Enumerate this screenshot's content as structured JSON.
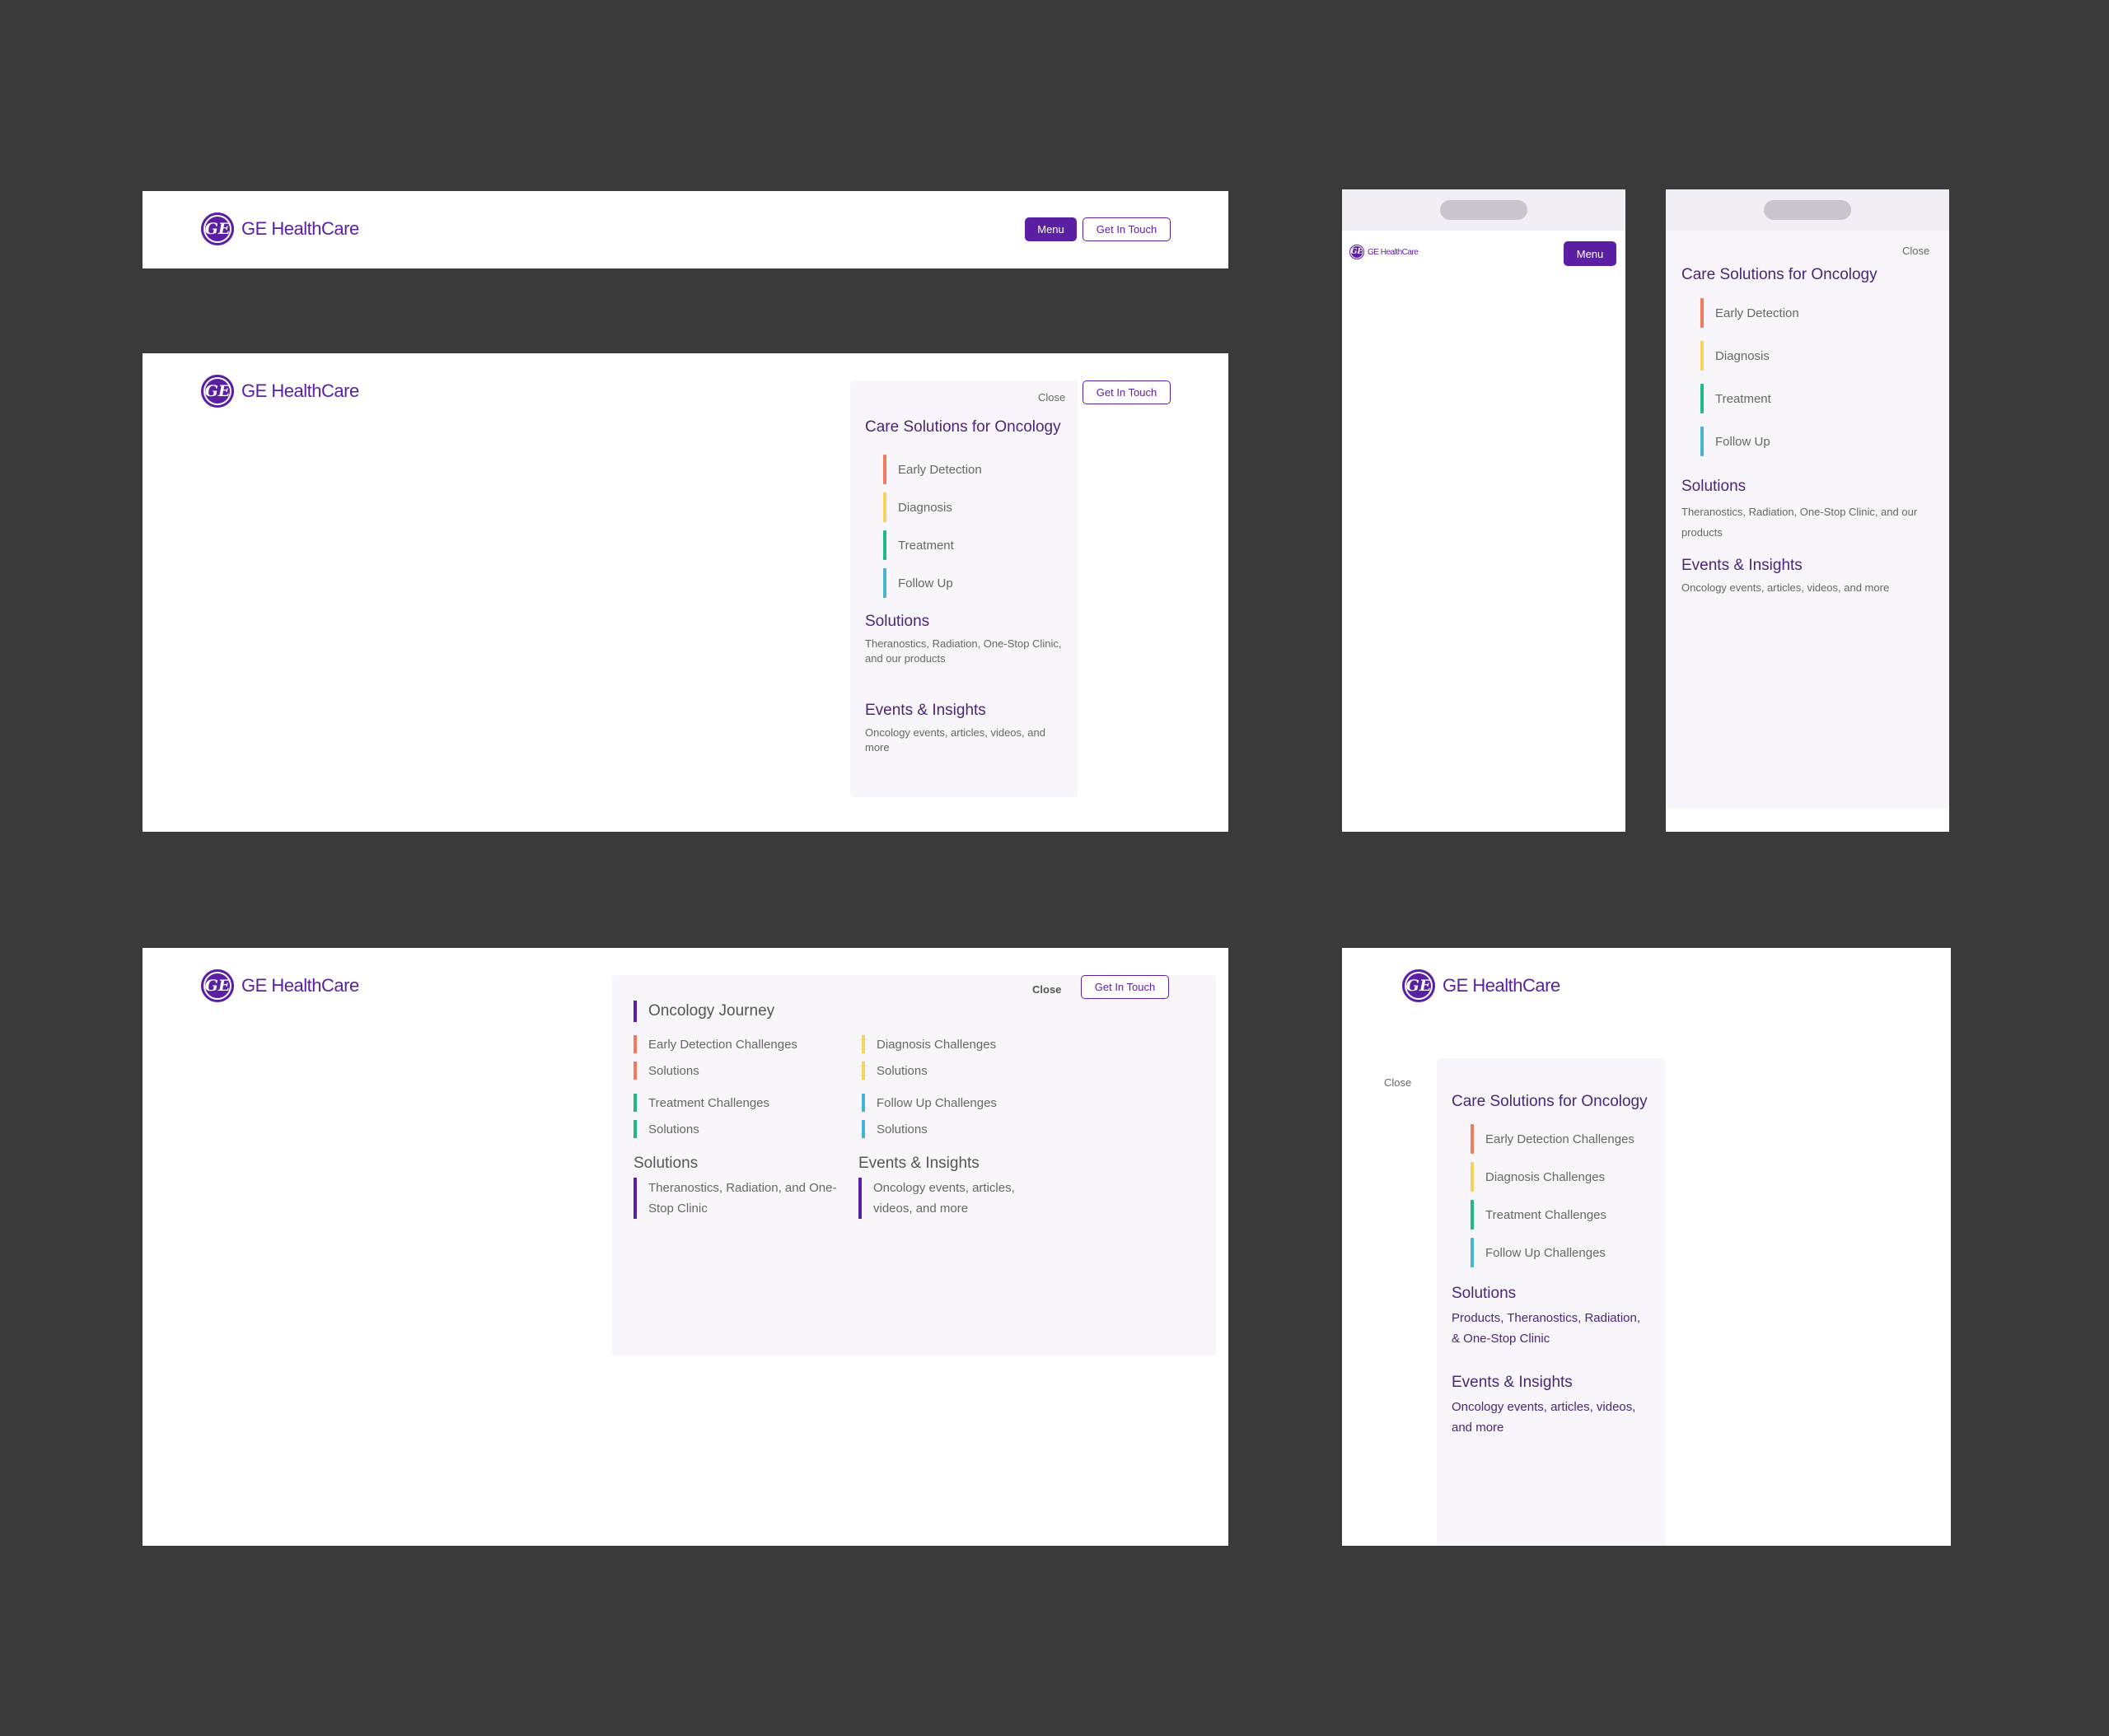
{
  "brand": {
    "name": "GE HealthCare",
    "monogram": "GE",
    "logo_icon": "ge-monogram-icon",
    "primary_color": "#5a1fa3"
  },
  "header": {
    "menu_label": "Menu",
    "cta_label": "Get In Touch",
    "close_label": "Close"
  },
  "journey_colors": {
    "early_detection": "#f07b5e",
    "diagnosis": "#f4d35e",
    "treatment": "#1fb886",
    "follow_up": "#48b4cf"
  },
  "care_menu": {
    "title": "Care Solutions for Oncology",
    "items": [
      "Early Detection",
      "Diagnosis",
      "Treatment",
      "Follow Up"
    ],
    "solutions": {
      "title": "Solutions",
      "desc": "Theranostics, Radiation, One-Stop Clinic, and our products"
    },
    "events": {
      "title": "Events & Insights",
      "desc": "Oncology events, articles, videos, and more"
    }
  },
  "care_menu_alt": {
    "items": [
      "Early Detection Challenges",
      "Diagnosis Challenges",
      "Treatment Challenges",
      "Follow Up Challenges"
    ],
    "solutions": {
      "title": "Solutions",
      "desc": "Products, Theranostics, Radiation, & One-Stop Clinic"
    },
    "events": {
      "title": "Events & Insights",
      "desc": "Oncology events, articles, videos, and more"
    }
  },
  "mega_menu": {
    "journey_title": "Oncology Journey",
    "early_detection": "Early Detection Challenges",
    "diagnosis": "Diagnosis Challenges",
    "treatment": "Treatment Challenges",
    "follow_up": "Follow Up Challenges",
    "solutions_link": "Solutions",
    "solutions": {
      "title": "Solutions",
      "desc": "Theranostics, Radiation, and One-Stop Clinic"
    },
    "events": {
      "title": "Events & Insights",
      "desc": "Oncology events, articles, videos, and more"
    }
  }
}
